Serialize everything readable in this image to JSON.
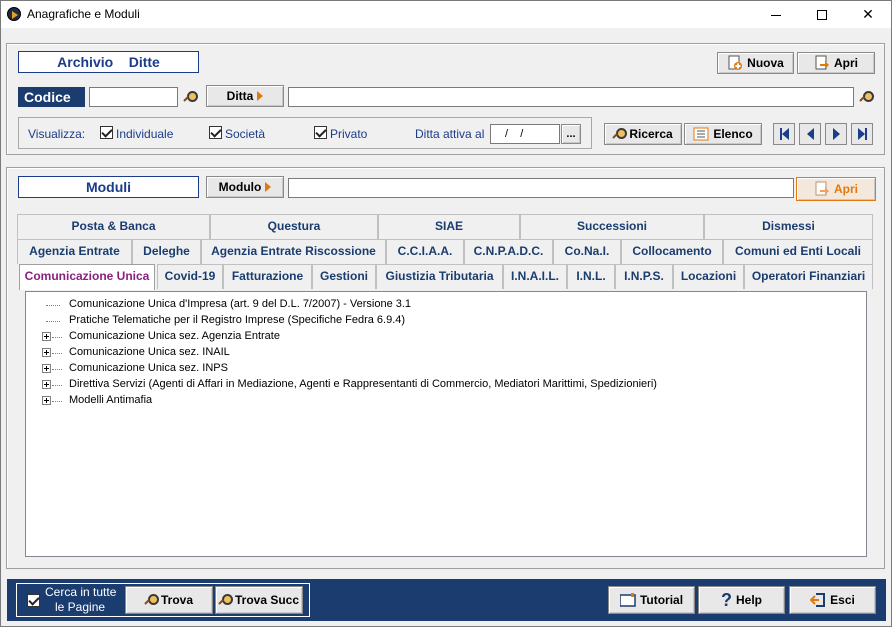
{
  "window": {
    "title": "Anagrafiche e Moduli"
  },
  "archivio": {
    "header": "Archivio    Ditte",
    "nuova_label": "Nuova",
    "apri_label": "Apri",
    "codice_label": "Codice",
    "codice_value": "",
    "ditta_label": "Ditta",
    "ditta_value": "",
    "visualizza_label": "Visualizza:",
    "checks": [
      {
        "label": "Individuale",
        "checked": true
      },
      {
        "label": "Società",
        "checked": true
      },
      {
        "label": "Privato",
        "checked": true
      }
    ],
    "ditta_attiva_label": "Ditta attiva al",
    "ditta_attiva_value": "/    /",
    "ellipsis": "...",
    "ricerca_label": "Ricerca",
    "elenco_label": "Elenco"
  },
  "moduli": {
    "header": "Moduli",
    "modulo_label": "Modulo",
    "modulo_value": "",
    "apri_label": "Apri",
    "tabs_row1": [
      "Posta & Banca",
      "Questura",
      "SIAE",
      "Successioni",
      "Dismessi"
    ],
    "tabs_row2": [
      "Agenzia Entrate",
      "Deleghe",
      "Agenzia Entrate Riscossione",
      "C.C.I.A.A.",
      "C.N.P.A.D.C.",
      "Co.Na.I.",
      "Collocamento",
      "Comuni ed Enti Locali"
    ],
    "tabs_row3": [
      "Comunicazione Unica",
      "Covid-19",
      "Fatturazione",
      "Gestioni",
      "Giustizia Tributaria",
      "I.N.A.I.L.",
      "I.N.L.",
      "I.N.P.S.",
      "Locazioni",
      "Operatori Finanziari"
    ],
    "active_tab": "Comunicazione Unica",
    "tree": [
      {
        "label": "Comunicazione Unica d'Impresa (art. 9 del D.L. 7/2007) - Versione 3.1",
        "expandable": false
      },
      {
        "label": "Pratiche Telematiche per il Registro Imprese (Specifiche Fedra 6.9.4)",
        "expandable": false
      },
      {
        "label": "Comunicazione Unica sez. Agenzia Entrate",
        "expandable": true
      },
      {
        "label": "Comunicazione Unica sez. INAIL",
        "expandable": true
      },
      {
        "label": "Comunicazione Unica sez. INPS",
        "expandable": true
      },
      {
        "label": "Direttiva Servizi  (Agenti di Affari in Mediazione, Agenti e Rappresentanti di Commercio, Mediatori Marittimi, Spedizionieri)",
        "expandable": true
      },
      {
        "label": "Modelli Antimafia",
        "expandable": true
      }
    ]
  },
  "bottom": {
    "cerca_label_1": "Cerca in tutte",
    "cerca_label_2": "le Pagine",
    "cerca_checked": true,
    "trova_label": "Trova",
    "trova_succ_label": "Trova Succ",
    "tutorial_label": "Tutorial",
    "help_label": "Help",
    "esci_label": "Esci"
  },
  "colors": {
    "navy": "#1a3c6e",
    "accent": "#e07a10",
    "tab_active_text": "#8a2080"
  }
}
